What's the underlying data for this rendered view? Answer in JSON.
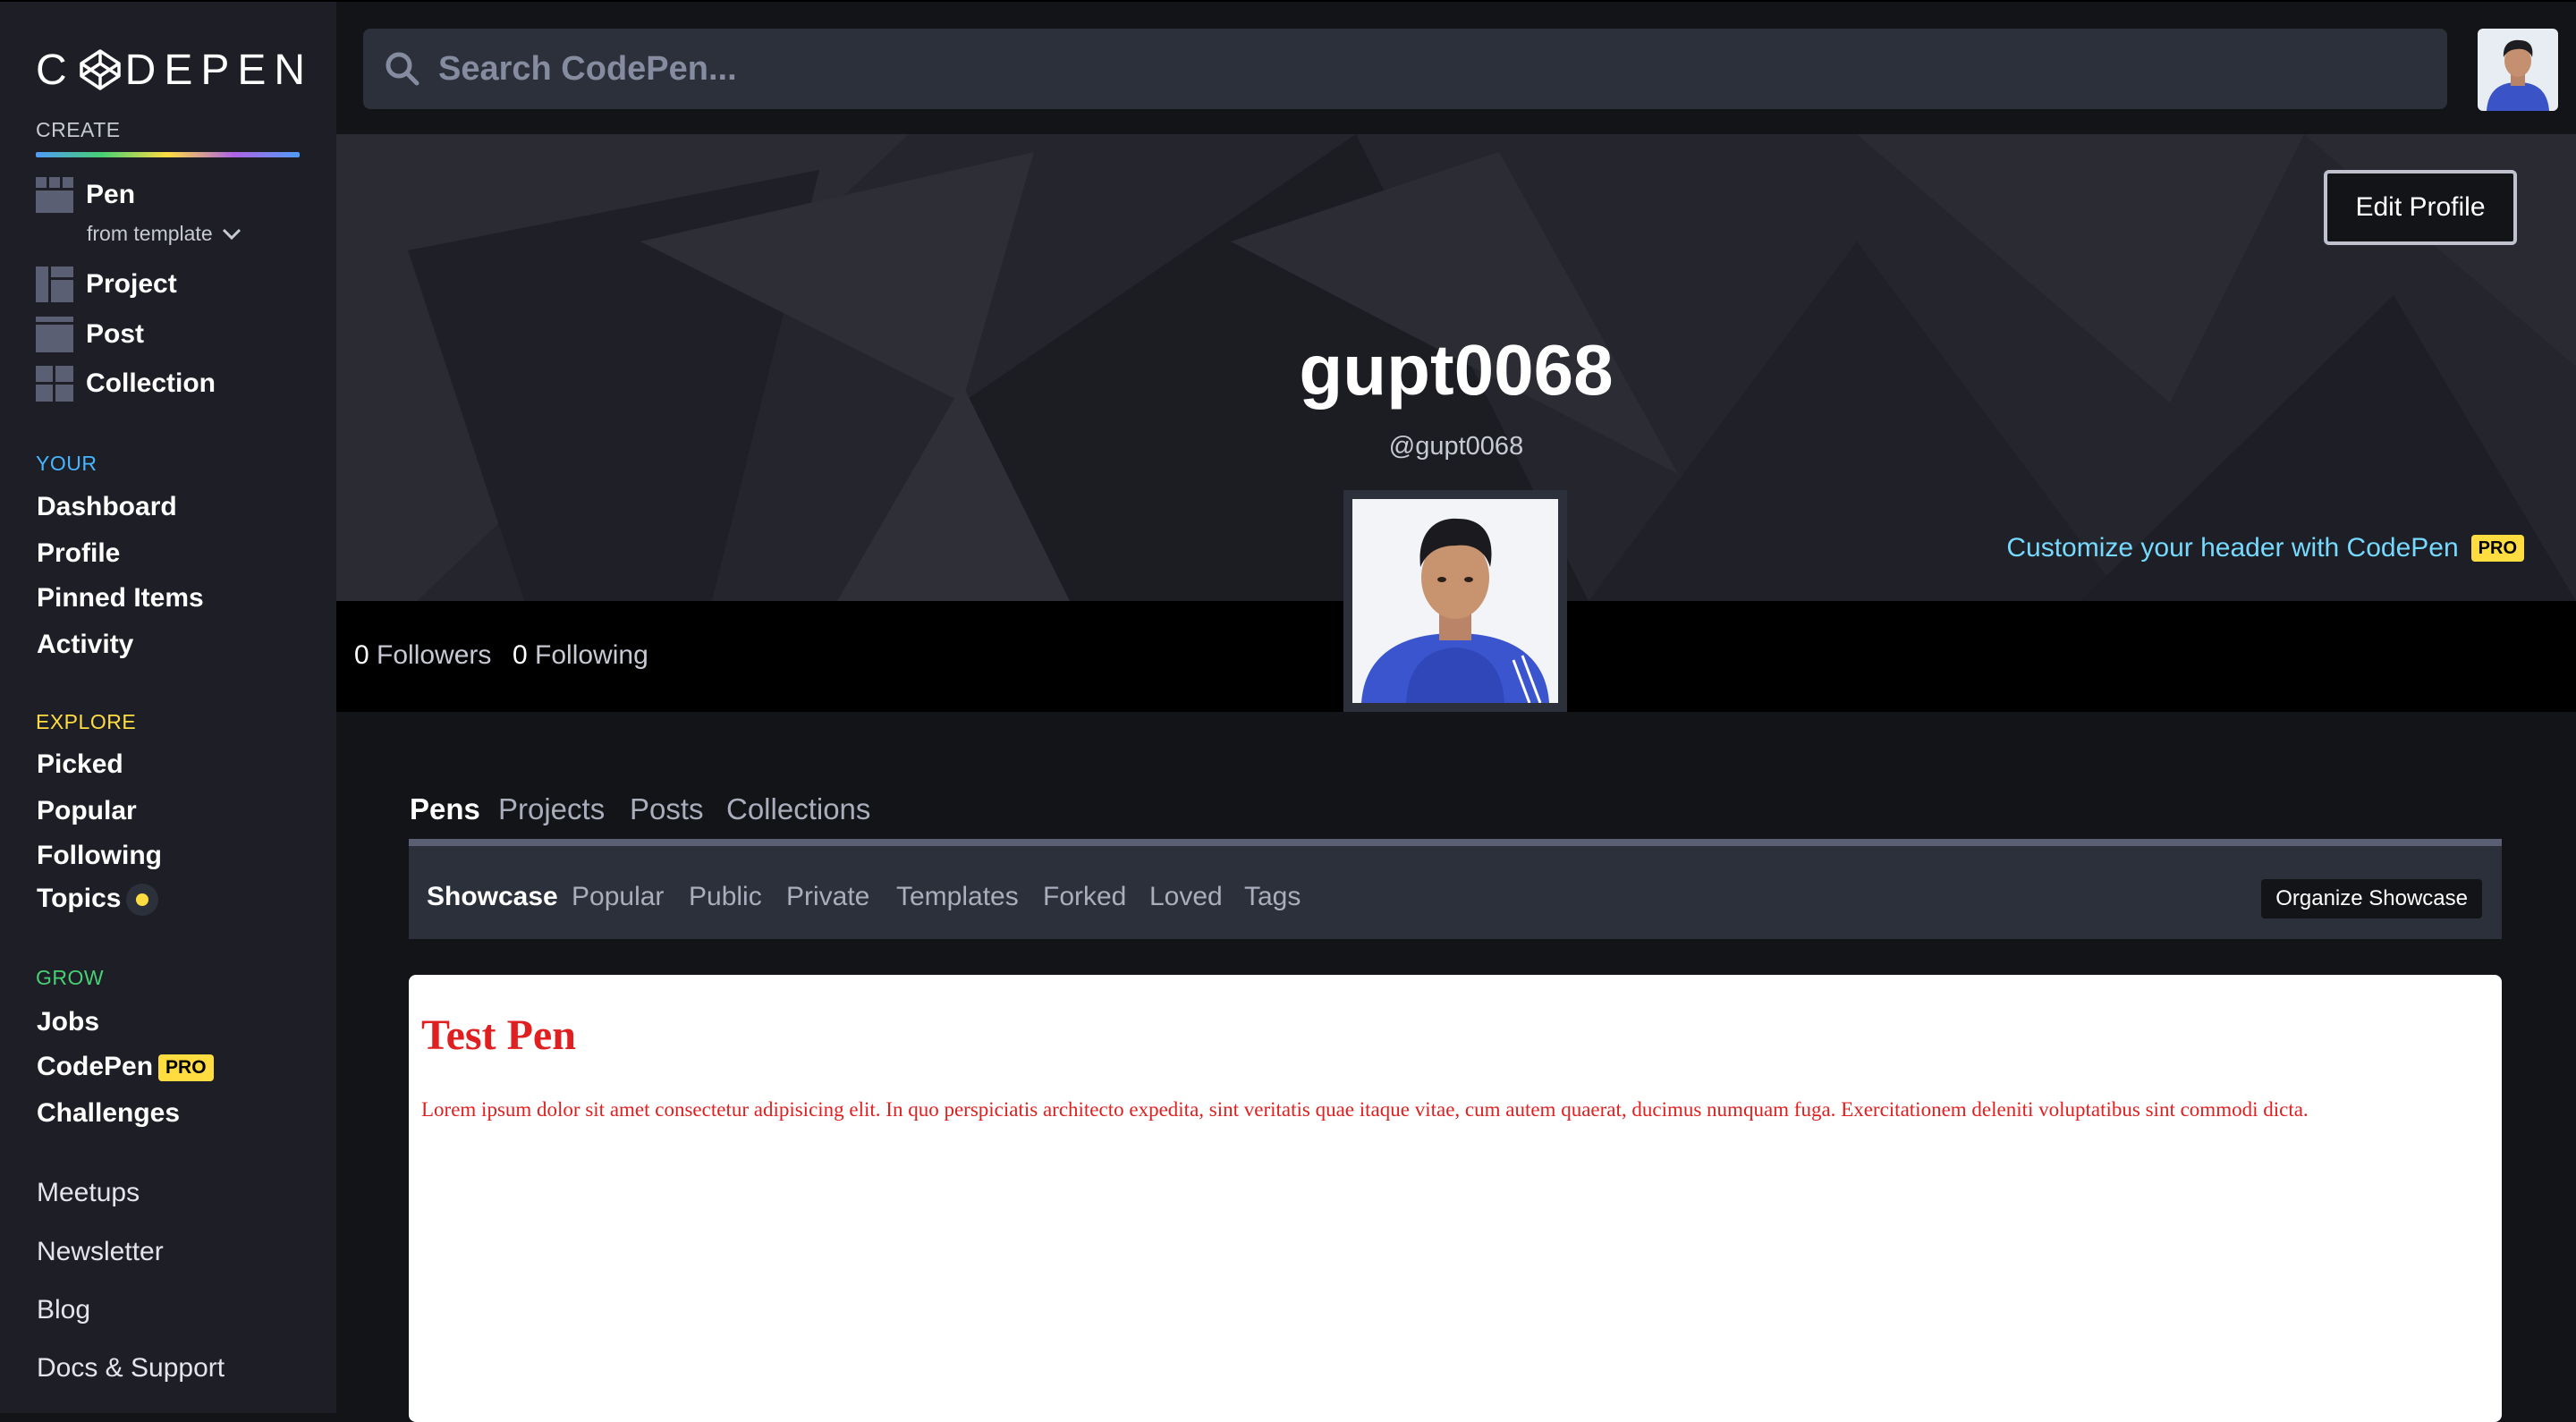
{
  "brand": {
    "logo_text": "DEPEN",
    "logo_prefix": "C"
  },
  "sidebar": {
    "create_label": "CREATE",
    "create_items": [
      {
        "label": "Pen",
        "icon": "pen-grid-icon"
      },
      {
        "label": "Project",
        "icon": "project-grid-icon"
      },
      {
        "label": "Post",
        "icon": "post-icon"
      },
      {
        "label": "Collection",
        "icon": "collection-grid-icon"
      }
    ],
    "from_template": "from template",
    "your_label": "YOUR",
    "your_items": [
      "Dashboard",
      "Profile",
      "Pinned Items",
      "Activity"
    ],
    "explore_label": "EXPLORE",
    "explore_items": [
      "Picked",
      "Popular",
      "Following",
      "Topics"
    ],
    "grow_label": "GROW",
    "grow_items": [
      "Jobs",
      "CodePen",
      "Challenges"
    ],
    "pro_badge": "PRO",
    "footer_items": [
      "Meetups",
      "Newsletter",
      "Blog",
      "Docs & Support"
    ],
    "colors": {
      "your": "#47b6ff",
      "explore": "#ffdd40",
      "grow": "#47cf73"
    }
  },
  "search": {
    "placeholder": "Search CodePen..."
  },
  "profile": {
    "name": "gupt0068",
    "handle": "@gupt0068",
    "edit_button": "Edit Profile",
    "customize_text": "Customize your header with CodePen",
    "customize_badge": "PRO",
    "followers_count": "0",
    "followers_label": "Followers",
    "following_count": "0",
    "following_label": "Following"
  },
  "tabs": {
    "main": [
      "Pens",
      "Projects",
      "Posts",
      "Collections"
    ],
    "active_main": "Pens",
    "sub": [
      "Showcase",
      "Popular",
      "Public",
      "Private",
      "Templates",
      "Forked",
      "Loved",
      "Tags"
    ],
    "active_sub": "Showcase",
    "organize_button": "Organize Showcase"
  },
  "pen": {
    "title": "Test Pen",
    "body": "Lorem ipsum dolor sit amet consectetur adipisicing elit. In quo perspiciatis architecto expedita, sint veritatis quae itaque vitae, cum autem quaerat, ducimus numquam fuga. Exercitationem deleniti voluptatibus sint commodi dicta."
  }
}
